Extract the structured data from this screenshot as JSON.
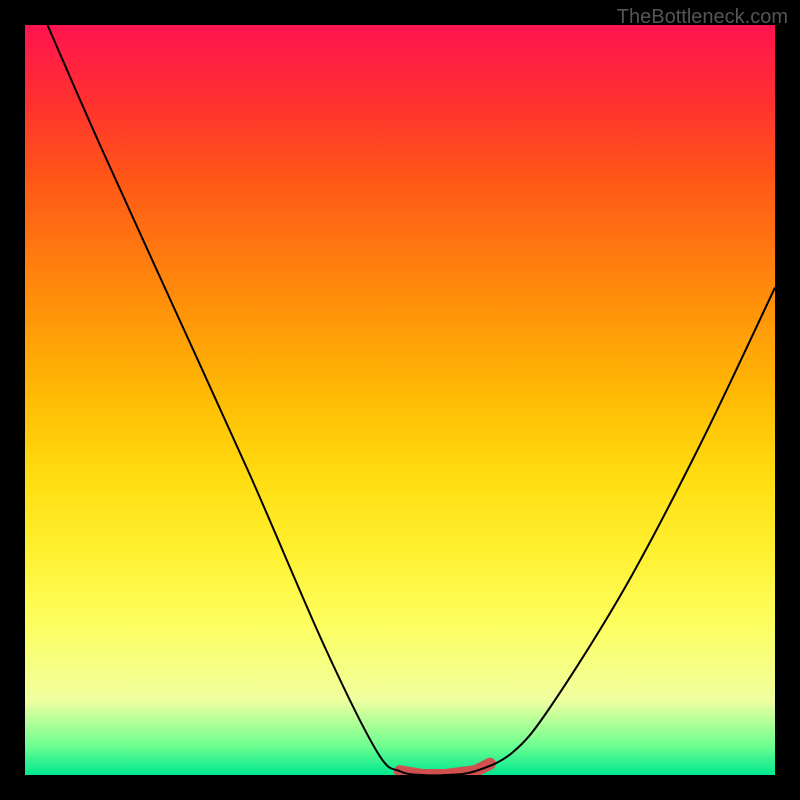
{
  "watermark": "TheBottleneck.com",
  "chart_data": {
    "type": "line",
    "title": "",
    "xlabel": "",
    "ylabel": "",
    "xlim": [
      0,
      100
    ],
    "ylim": [
      0,
      100
    ],
    "gradient_colors": [
      "#ff1450",
      "#ff9a08",
      "#ffdc10",
      "#fdff60",
      "#00e890"
    ],
    "series": [
      {
        "name": "bottleneck-curve",
        "x": [
          3,
          10,
          20,
          30,
          40,
          47,
          50,
          53,
          56,
          60,
          65,
          70,
          80,
          90,
          100
        ],
        "y": [
          100,
          84,
          62,
          40,
          17,
          3,
          0.5,
          0,
          0,
          0.5,
          3,
          9,
          25,
          44,
          65
        ]
      }
    ],
    "highlight_segment": {
      "x_start": 50,
      "x_end": 62,
      "color": "#d05050",
      "width": 12
    }
  }
}
